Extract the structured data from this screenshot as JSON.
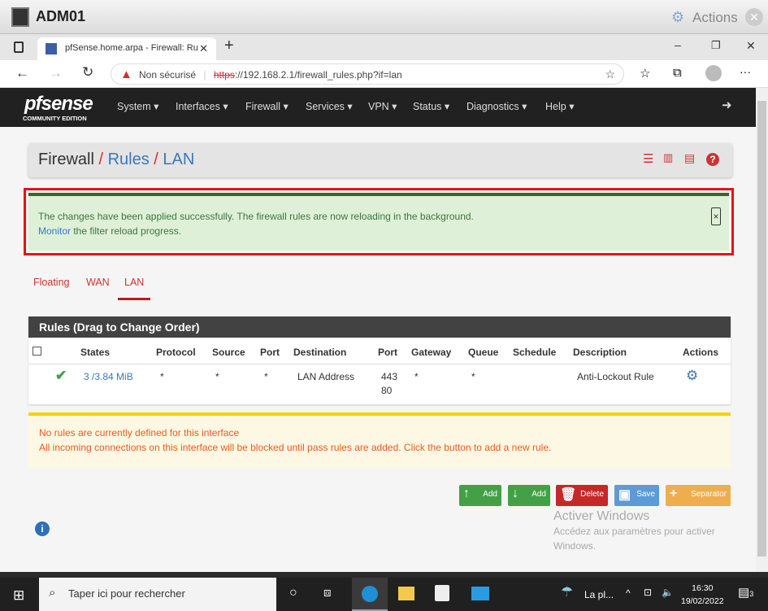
{
  "window": {
    "title": "ADM01",
    "actions_label": "Actions"
  },
  "browser": {
    "tab_title": "pfSense.home.arpa - Firewall: Ru",
    "security_label": "Non sécurisé",
    "url_scheme": "https",
    "url_rest": "://192.168.2.1/firewall_rules.php?if=lan"
  },
  "nav": {
    "logo": "pfsense",
    "logo_sub": "COMMUNITY EDITION",
    "items": [
      "System",
      "Interfaces",
      "Firewall",
      "Services",
      "VPN",
      "Status",
      "Diagnostics",
      "Help"
    ]
  },
  "breadcrumb": {
    "root": "Firewall",
    "sep": "/",
    "items": [
      "Rules",
      "LAN"
    ]
  },
  "alert": {
    "message": "The changes have been applied successfully. The firewall rules are now reloading in the background.",
    "link": "Monitor",
    "link_suffix": " the filter reload progress."
  },
  "tabs": [
    {
      "label": "Floating",
      "active": false
    },
    {
      "label": "WAN",
      "active": false
    },
    {
      "label": "LAN",
      "active": true
    }
  ],
  "rules_panel": {
    "title": "Rules (Drag to Change Order)",
    "columns": [
      "States",
      "Protocol",
      "Source",
      "Port",
      "Destination",
      "Port",
      "Gateway",
      "Queue",
      "Schedule",
      "Description",
      "Actions"
    ],
    "rows": [
      {
        "states": "3 /3.84 MiB",
        "protocol": "*",
        "source": "*",
        "port": "*",
        "destination": "LAN Address",
        "dest_port_1": "443",
        "dest_port_2": "80",
        "gateway": "*",
        "queue": "*",
        "schedule": "",
        "description": "Anti-Lockout Rule"
      }
    ]
  },
  "warning": {
    "line1": "No rules are currently defined for this interface",
    "line2": "All incoming connections on this interface will be blocked until pass rules are added. Click the button to add a new rule."
  },
  "buttons": [
    {
      "label": "Add",
      "color": "#43a047"
    },
    {
      "label": "Add",
      "color": "#43a047"
    },
    {
      "label": "Delete",
      "color": "#c62828"
    },
    {
      "label": "Save",
      "color": "#5c9bd8"
    },
    {
      "label": "Separator",
      "color": "#f0ad4e"
    }
  ],
  "activation": {
    "title": "Activer Windows",
    "text1": "Accédez aux paramètres pour activer",
    "text2": "Windows."
  },
  "taskbar": {
    "search_placeholder": "Taper ici pour rechercher",
    "weather": "La pl...",
    "time": "16:30",
    "date": "19/02/2022",
    "notif_count": "3"
  }
}
